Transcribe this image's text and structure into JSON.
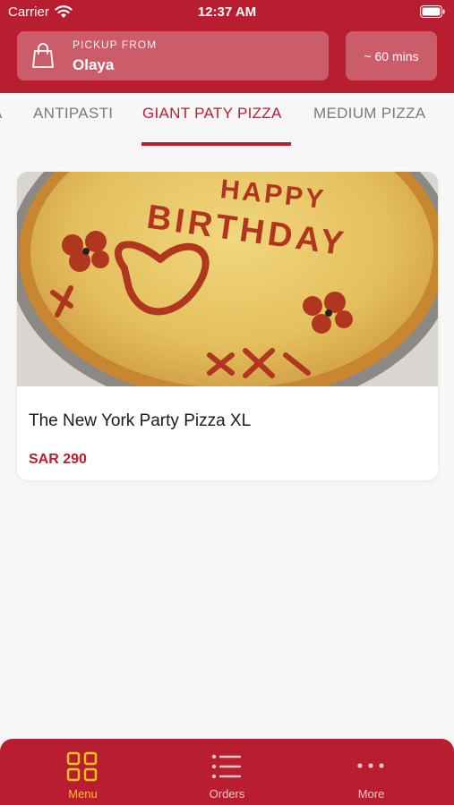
{
  "status_bar": {
    "carrier": "Carrier",
    "time": "12:37 AM"
  },
  "header": {
    "pickup_label": "PICKUP FROM",
    "pickup_value": "Olaya",
    "eta": "~ 60 mins"
  },
  "categories": {
    "items": [
      {
        "label": "A"
      },
      {
        "label": "ANTIPASTI"
      },
      {
        "label": "GIANT PATY PIZZA",
        "active": true
      },
      {
        "label": "MEDIUM PIZZA"
      }
    ]
  },
  "products": [
    {
      "image_text_line1": "HAPPY",
      "image_text_line2": "BIRTHDAY",
      "name": "The New York Party Pizza XL",
      "price": "SAR 290"
    }
  ],
  "tabbar": {
    "items": [
      {
        "label": "Menu",
        "icon": "grid-icon",
        "active": true
      },
      {
        "label": "Orders",
        "icon": "list-icon"
      },
      {
        "label": "More",
        "icon": "more-icon"
      }
    ]
  },
  "colors": {
    "brand": "#b81e30",
    "active_tab_icon": "#f5c518",
    "background": "#f7f7f7"
  }
}
